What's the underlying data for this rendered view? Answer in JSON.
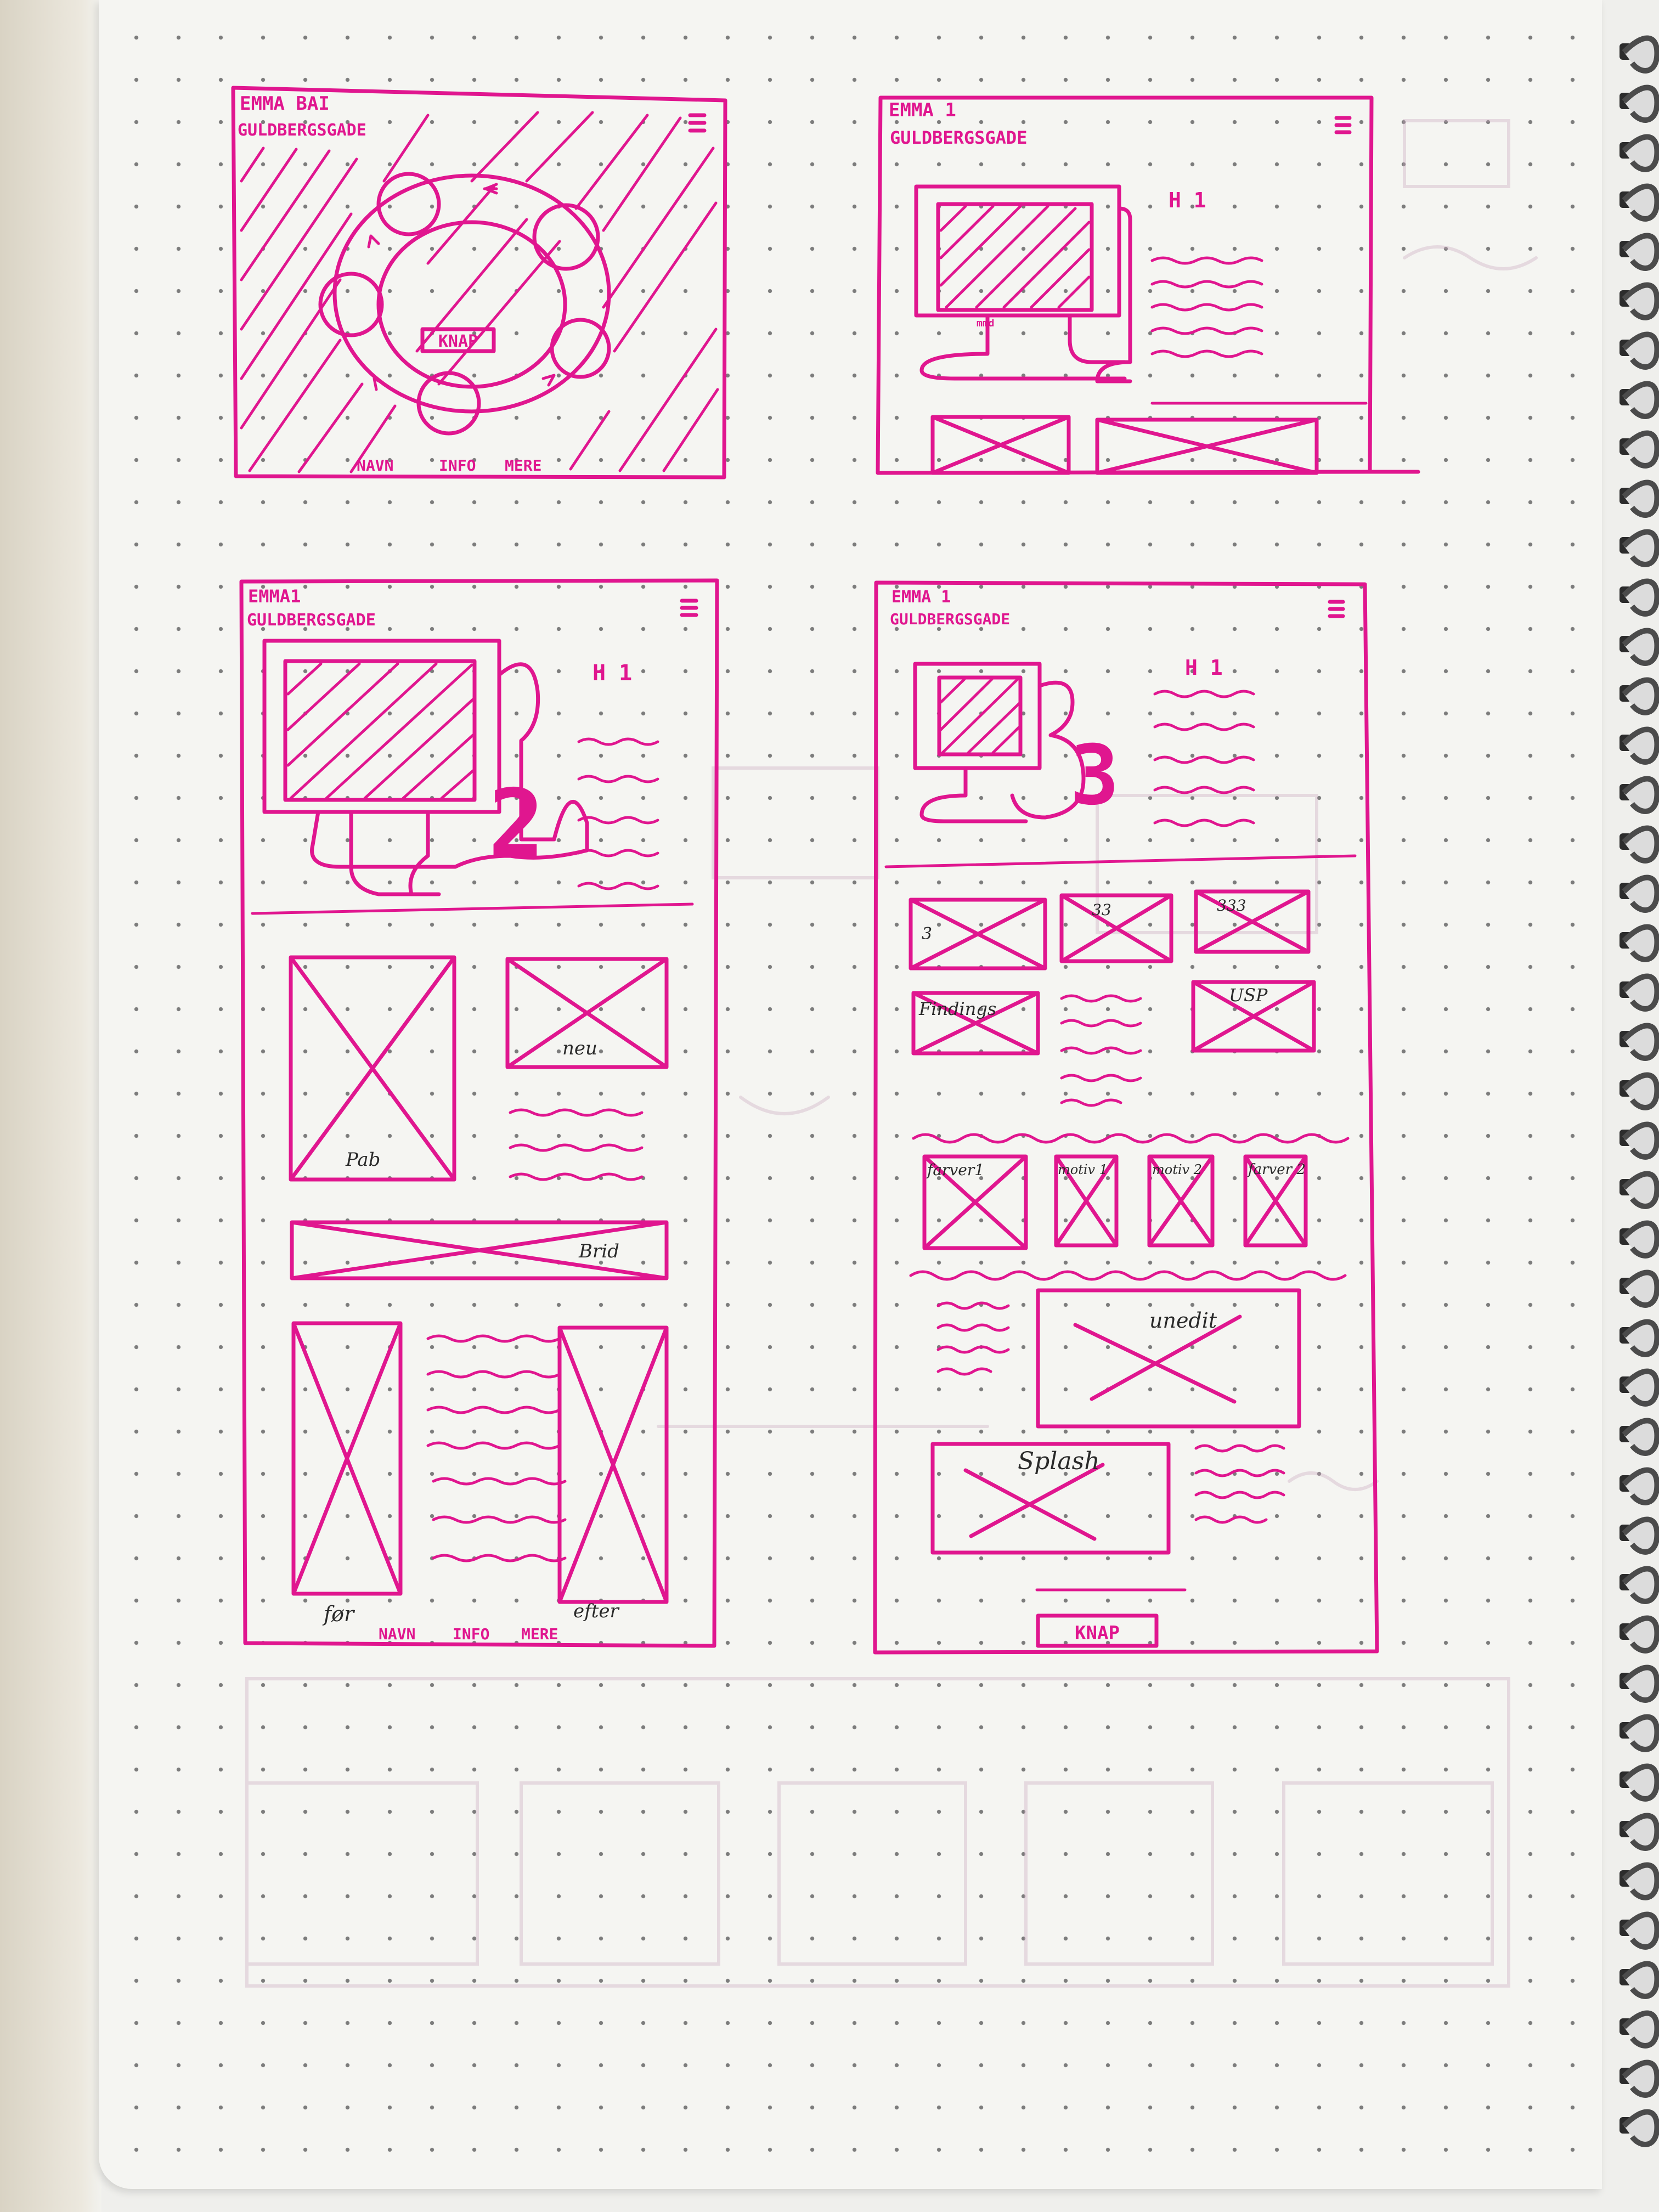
{
  "sketch": {
    "ink_color": "#e0168f",
    "paper_color": "#f5f5f2",
    "wireframe_a": {
      "header_line1": "EMMA BAI",
      "header_line2": "GULDBERGSGADE",
      "menu_icon": "hamburger-icon",
      "button_label": "KNAP",
      "footer_nav": [
        "NAVN",
        "INFO",
        "MERE"
      ]
    },
    "wireframe_b": {
      "header_line1": "EMMA 1",
      "header_line2": "GULDBERGSGADE",
      "menu_icon": "hamburger-icon",
      "heading": "H 1",
      "monitor_label": "mmd"
    },
    "wireframe_c": {
      "header_line1": "EMMA1",
      "header_line2": "GULDBERGSGADE",
      "menu_icon": "hamburger-icon",
      "heading": "H 1",
      "number": "2",
      "image_label_1": "Pab",
      "image_label_2": "neu",
      "banner_label": "Brid",
      "before_label": "før",
      "after_label": "efter",
      "footer_nav": [
        "NAVN",
        "INFO",
        "MERE"
      ]
    },
    "wireframe_d": {
      "header_line1": "EMMA 1",
      "header_line2": "GULDBERGSGADE",
      "menu_icon": "hamburger-icon",
      "heading": "H 1",
      "number": "3",
      "box_labels": [
        "3",
        "33",
        "333"
      ],
      "findings_label": "Findings",
      "usp_label": "USP",
      "colors_labels": [
        "farver1",
        "motiv 1",
        "motiv 2",
        "farver 2"
      ],
      "unedit_label": "unedit",
      "splash_label": "Splash",
      "button_label": "KNAP"
    }
  }
}
